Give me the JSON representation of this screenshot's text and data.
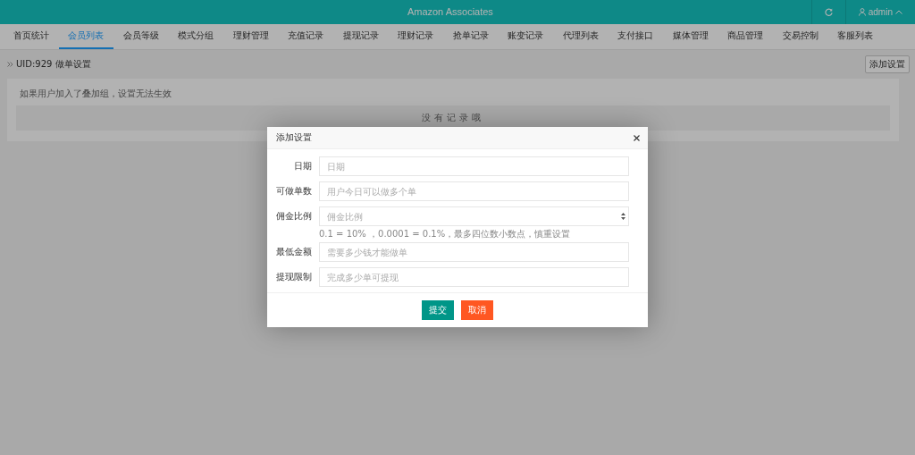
{
  "header": {
    "title": "Amazon Associates",
    "user": "admin"
  },
  "nav": [
    {
      "label": "首页统计",
      "selected": false
    },
    {
      "label": "会员列表",
      "selected": true
    },
    {
      "label": "会员等级",
      "selected": false
    },
    {
      "label": "模式分组",
      "selected": false
    },
    {
      "label": "理财管理",
      "selected": false
    },
    {
      "label": "充值记录",
      "selected": false
    },
    {
      "label": "提现记录",
      "selected": false
    },
    {
      "label": "理财记录",
      "selected": false
    },
    {
      "label": "抢单记录",
      "selected": false
    },
    {
      "label": "账变记录",
      "selected": false
    },
    {
      "label": "代理列表",
      "selected": false
    },
    {
      "label": "支付接口",
      "selected": false
    },
    {
      "label": "媒体管理",
      "selected": false
    },
    {
      "label": "商品管理",
      "selected": false
    },
    {
      "label": "交易控制",
      "selected": false
    },
    {
      "label": "客服列表",
      "selected": false
    }
  ],
  "breadcrumb": "UID:929 做单设置",
  "add_button": "添加设置",
  "notice": "如果用户加入了叠加组，设置无法生效",
  "empty_text": "没有记录哦",
  "dialog": {
    "title": "添加设置",
    "fields": [
      {
        "kind": "text",
        "label": "日期",
        "placeholder": "日期"
      },
      {
        "kind": "text",
        "label": "可做单数",
        "placeholder": "用户今日可以做多个单"
      },
      {
        "kind": "number",
        "label": "佣金比例",
        "placeholder": "佣金比例",
        "hint": "0.1 = 10% ，0.0001 = 0.1%，最多四位数小数点，慎重设置"
      },
      {
        "kind": "text",
        "label": "最低金额",
        "placeholder": "需要多少钱才能做单"
      },
      {
        "kind": "text",
        "label": "提现限制",
        "placeholder": "完成多少单可提现"
      }
    ],
    "buttons": [
      {
        "kind": "primary",
        "label": "提交"
      },
      {
        "kind": "danger",
        "label": "取消"
      }
    ]
  }
}
